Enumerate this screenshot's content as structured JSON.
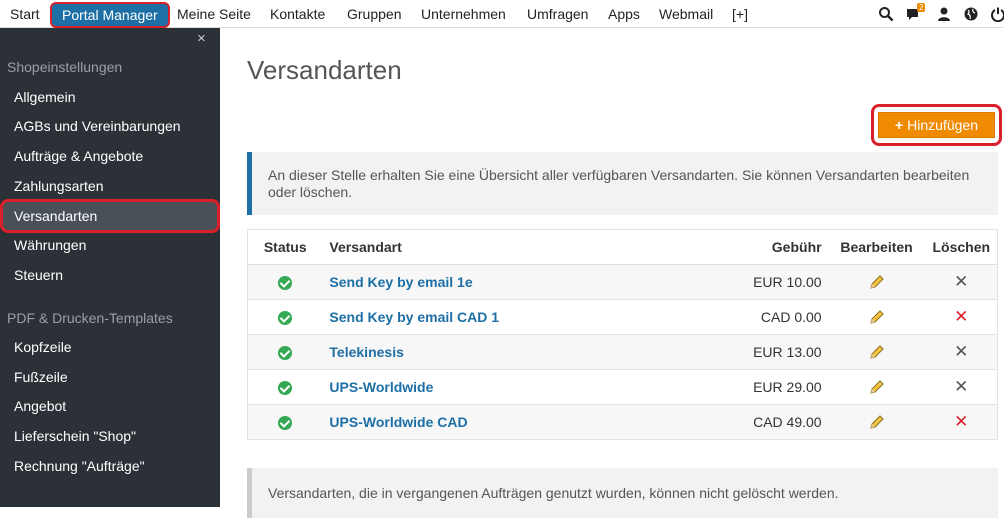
{
  "topnav": {
    "items": [
      "Start",
      "Portal Manager",
      "Meine Seite",
      "Kontakte",
      "Gruppen",
      "Unternehmen",
      "Umfragen",
      "Apps",
      "Webmail",
      "[+]"
    ],
    "notification_count": "2"
  },
  "sidebar": {
    "close": "×",
    "section1": "Shopeinstellungen",
    "shop_items": [
      "Allgemein",
      "AGBs und Vereinbarungen",
      "Aufträge & Angebote",
      "Zahlungsarten",
      "Versandarten",
      "Währungen",
      "Steuern"
    ],
    "section2": "PDF & Drucken-Templates",
    "pdf_items": [
      "Kopfzeile",
      "Fußzeile",
      "Angebot",
      "Lieferschein \"Shop\"",
      "Rechnung \"Aufträge\""
    ]
  },
  "page": {
    "title": "Versandarten",
    "add_label": "Hinzufügen",
    "info_text": "An dieser Stelle erhalten Sie eine Übersicht aller verfügbaren Versandarten. Sie können Versandarten bearbeiten oder löschen.",
    "footer_info": "Versandarten, die in vergangenen Aufträgen genutzt wurden, können nicht gelöscht werden."
  },
  "table": {
    "headers": {
      "status": "Status",
      "name": "Versandart",
      "fee": "Gebühr",
      "edit": "Bearbeiten",
      "delete": "Löschen"
    },
    "rows": [
      {
        "name": "Send Key by email 1e",
        "fee": "EUR 10.00",
        "deletable": false
      },
      {
        "name": "Send Key by email CAD 1",
        "fee": "CAD 0.00",
        "deletable": true
      },
      {
        "name": "Telekinesis",
        "fee": "EUR 13.00",
        "deletable": false
      },
      {
        "name": "UPS-Worldwide",
        "fee": "EUR 29.00",
        "deletable": false
      },
      {
        "name": "UPS-Worldwide CAD",
        "fee": "CAD 49.00",
        "deletable": true
      }
    ]
  },
  "colors": {
    "accent": "#1d6fa5",
    "add_button": "#f08a00",
    "delete_active": "#d9212b",
    "delete_disabled": "#555555",
    "status_ok": "#35a853"
  }
}
